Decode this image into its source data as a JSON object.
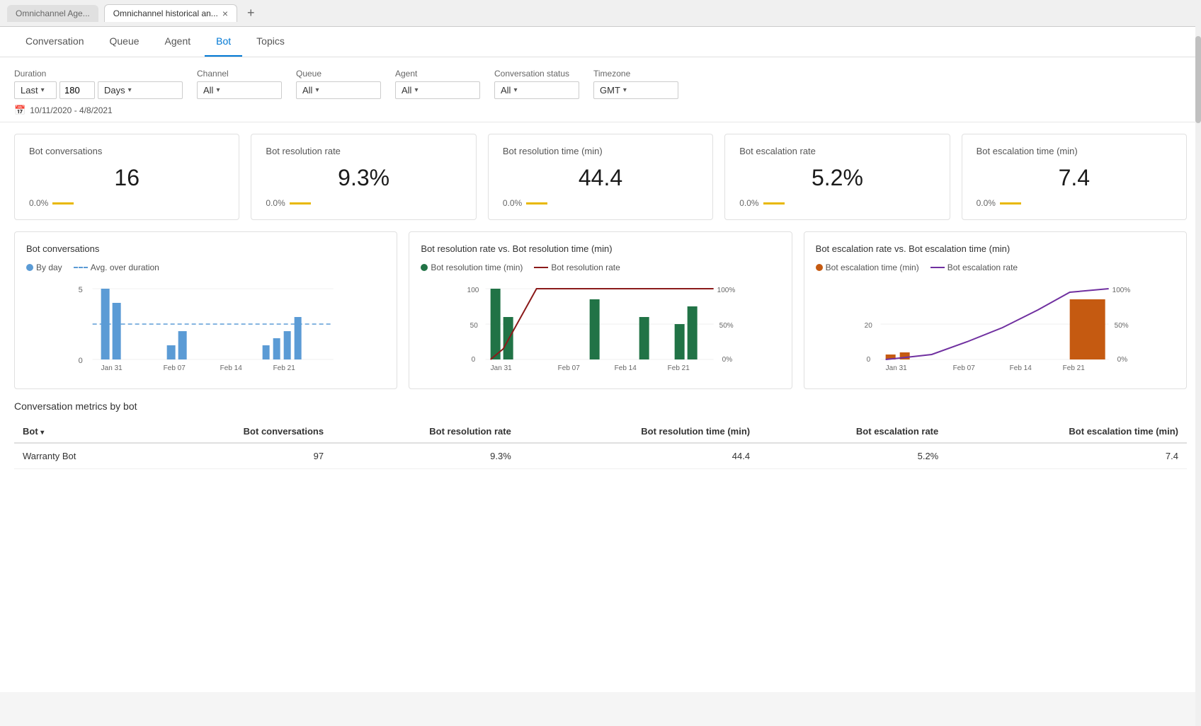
{
  "browser": {
    "tab_inactive": "Omnichannel Age...",
    "tab_active": "Omnichannel historical an...",
    "close_icon": "×",
    "add_icon": "+"
  },
  "nav": {
    "tabs": [
      {
        "id": "conversation",
        "label": "Conversation",
        "active": false
      },
      {
        "id": "queue",
        "label": "Queue",
        "active": false
      },
      {
        "id": "agent",
        "label": "Agent",
        "active": false
      },
      {
        "id": "bot",
        "label": "Bot",
        "active": true
      },
      {
        "id": "topics",
        "label": "Topics",
        "active": false
      }
    ]
  },
  "filters": {
    "duration_label": "Duration",
    "duration_preset": "Last",
    "duration_value": "180",
    "duration_unit": "Days",
    "channel_label": "Channel",
    "channel_value": "All",
    "queue_label": "Queue",
    "queue_value": "All",
    "agent_label": "Agent",
    "agent_value": "All",
    "conv_status_label": "Conversation status",
    "conv_status_value": "All",
    "timezone_label": "Timezone",
    "timezone_value": "GMT",
    "date_range": "10/11/2020 - 4/8/2021"
  },
  "metric_cards": [
    {
      "title": "Bot conversations",
      "value": "16",
      "change": "0.0%",
      "id": "bot-conversations"
    },
    {
      "title": "Bot resolution rate",
      "value": "9.3%",
      "change": "0.0%",
      "id": "bot-resolution-rate"
    },
    {
      "title": "Bot resolution time (min)",
      "value": "44.4",
      "change": "0.0%",
      "id": "bot-resolution-time"
    },
    {
      "title": "Bot escalation rate",
      "value": "5.2%",
      "change": "0.0%",
      "id": "bot-escalation-rate"
    },
    {
      "title": "Bot escalation time (min)",
      "value": "7.4",
      "change": "0.0%",
      "id": "bot-escalation-time"
    }
  ],
  "charts": {
    "bot_conversations": {
      "title": "Bot conversations",
      "legend_by_day": "By day",
      "legend_avg": "Avg. over duration",
      "x_labels": [
        "Jan 31",
        "Feb 07",
        "Feb 14",
        "Feb 21"
      ],
      "y_labels": [
        "0",
        "5"
      ]
    },
    "resolution_vs_time": {
      "title": "Bot resolution rate vs. Bot resolution time (min)",
      "legend_time": "Bot resolution time (min)",
      "legend_rate": "Bot resolution rate",
      "x_labels": [
        "Jan 31",
        "Feb 07",
        "Feb 14",
        "Feb 21"
      ],
      "y_left": [
        "0",
        "50",
        "100"
      ],
      "y_right": [
        "0%",
        "50%",
        "100%"
      ]
    },
    "escalation_vs_time": {
      "title": "Bot escalation rate vs. Bot escalation time (min)",
      "legend_time": "Bot escalation time (min)",
      "legend_rate": "Bot escalation rate",
      "x_labels": [
        "Jan 31",
        "Feb 07",
        "Feb 14",
        "Feb 21"
      ],
      "y_left": [
        "0",
        "20"
      ],
      "y_right": [
        "0%",
        "50%",
        "100%"
      ]
    }
  },
  "table": {
    "title": "Conversation metrics by bot",
    "headers": [
      {
        "label": "Bot",
        "sortable": true
      },
      {
        "label": "Bot conversations",
        "sortable": false
      },
      {
        "label": "Bot resolution rate",
        "sortable": false
      },
      {
        "label": "Bot resolution time (min)",
        "sortable": false
      },
      {
        "label": "Bot escalation rate",
        "sortable": false
      },
      {
        "label": "Bot escalation time (min)",
        "sortable": false
      }
    ],
    "rows": [
      {
        "bot": "Warranty Bot",
        "conversations": "97",
        "resolution_rate": "9.3%",
        "resolution_time": "44.4",
        "escalation_rate": "5.2%",
        "escalation_time": "7.4"
      }
    ]
  },
  "colors": {
    "accent_blue": "#0078d4",
    "bar_blue": "#5b9bd5",
    "bar_green": "#217346",
    "bar_orange": "#c55a11",
    "line_red": "#8b1a1a",
    "line_purple": "#7030a0",
    "avg_dashed": "#5b9bd5",
    "yellow_bar": "#e8b800"
  }
}
